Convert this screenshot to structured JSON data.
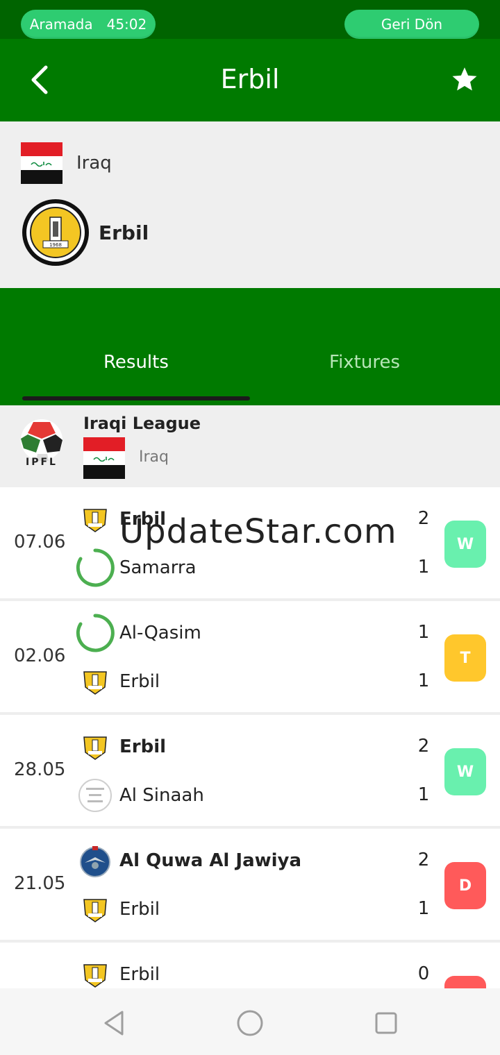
{
  "status_bar": {
    "call_label": "Aramada",
    "call_timer": "45:02",
    "return_label": "Geri Dön"
  },
  "app_bar": {
    "title": "Erbil",
    "back_icon": "chevron-left-icon",
    "favorite_icon": "star-icon"
  },
  "team_header": {
    "country": "Iraq",
    "club": "Erbil"
  },
  "tabs": [
    {
      "label": "Results",
      "active": true
    },
    {
      "label": "Fixtures",
      "active": false
    }
  ],
  "league": {
    "name": "Iraqi League",
    "country": "Iraq",
    "logo_text": "IPFL"
  },
  "watermark": "UpdateStar.com",
  "matches": [
    {
      "date": "07.06",
      "home": "Erbil",
      "away": "Samarra",
      "home_score": "2",
      "away_score": "1",
      "result": "W"
    },
    {
      "date": "02.06",
      "home": "Al-Qasim",
      "away": "Erbil",
      "home_score": "1",
      "away_score": "1",
      "result": "T"
    },
    {
      "date": "28.05",
      "home": "Erbil",
      "away": "Al Sinaah",
      "home_score": "2",
      "away_score": "1",
      "result": "W"
    },
    {
      "date": "21.05",
      "home": "Al Quwa Al Jawiya",
      "away": "Erbil",
      "home_score": "2",
      "away_score": "1",
      "result": "D"
    },
    {
      "date": "",
      "home": "Erbil",
      "away": "",
      "home_score": "0",
      "away_score": "",
      "result": ""
    }
  ],
  "colors": {
    "status_bar": "#006400",
    "primary": "#007a00",
    "pill": "#2ecc71",
    "win": "#69f0ae",
    "draw": "#ffc72c",
    "loss": "#ff5a5a"
  },
  "nav": {
    "back_icon": "triangle-back-icon",
    "home_icon": "circle-home-icon",
    "recent_icon": "square-recent-icon"
  }
}
